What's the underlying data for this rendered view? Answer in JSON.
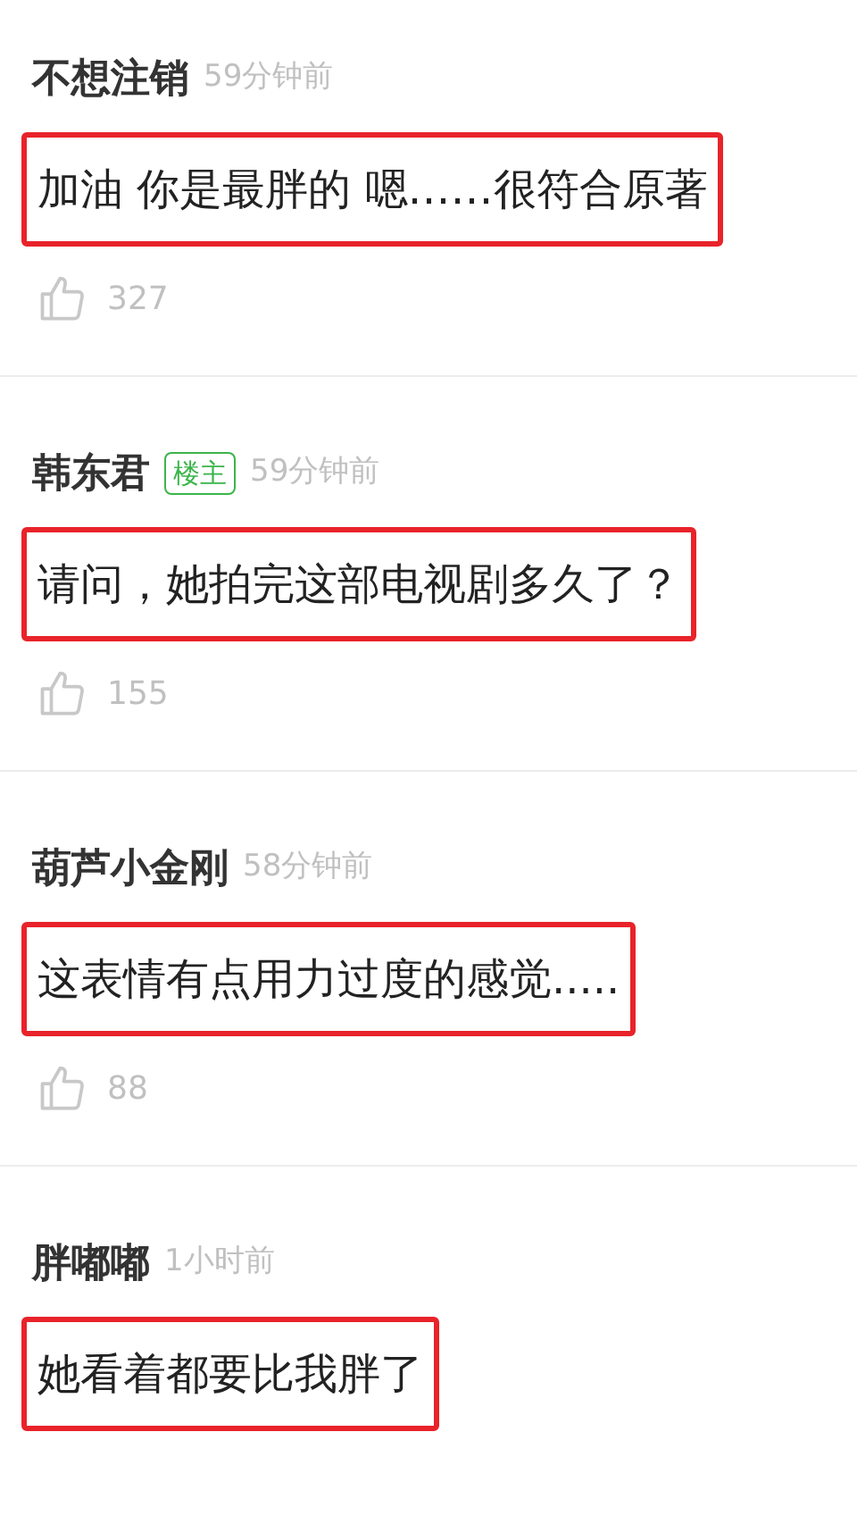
{
  "comments": [
    {
      "author": "不想注销",
      "time": "59分钟前",
      "text": "加油 你是最胖的 嗯……很符合原著",
      "highlighted": true,
      "likes": "327"
    },
    {
      "author": "韩东君",
      "badge": "楼主",
      "time": "59分钟前",
      "text": "请问，她拍完这部电视剧多久了？",
      "highlighted": true,
      "likes": "155"
    },
    {
      "author": "葫芦小金刚",
      "time": "58分钟前",
      "text": "这表情有点用力过度的感觉.....",
      "highlighted": true,
      "likes": "88"
    },
    {
      "author": "胖嘟嘟",
      "time": "1小时前",
      "text": "她看着都要比我胖了",
      "highlighted": true
    }
  ]
}
